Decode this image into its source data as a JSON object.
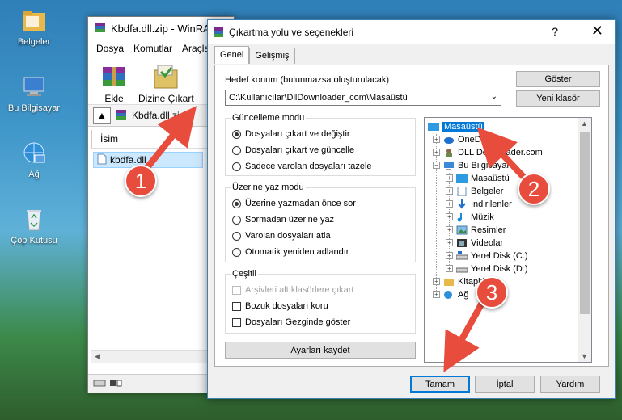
{
  "desktop": {
    "icons": [
      {
        "label": "Belgeler"
      },
      {
        "label": "Bu Bilgisayar"
      },
      {
        "label": "Ağ"
      },
      {
        "label": "Çöp Kutusu"
      }
    ]
  },
  "winrar": {
    "title": "Kbdfa.dll.zip - WinRA",
    "menu": [
      "Dosya",
      "Komutlar",
      "Araçla"
    ],
    "toolbar": {
      "add": "Ekle",
      "extract_to": "Dizine Çıkart"
    },
    "address": "Kbdfa.dll.zip",
    "column_name": "İsim",
    "file": "kbdfa.dll"
  },
  "dialog": {
    "title": "Çıkartma yolu ve seçenekleri",
    "help_symbol": "?",
    "close_symbol": "✕",
    "tabs": [
      "Genel",
      "Gelişmiş"
    ],
    "dest_label": "Hedef konum (bulunmazsa oluşturulacak)",
    "dest_value": "C:\\Kullanıcılar\\DllDownloader_com\\Masaüstü",
    "btn_show": "Göster",
    "btn_new_folder": "Yeni klasör",
    "update_group": {
      "title": "Güncelleme modu",
      "options": [
        "Dosyaları çıkart ve değiştir",
        "Dosyaları çıkart ve güncelle",
        "Sadece varolan dosyaları tazele"
      ],
      "selected": 0
    },
    "overwrite_group": {
      "title": "Üzerine yaz modu",
      "options": [
        "Üzerine yazmadan önce sor",
        "Sormadan üzerine yaz",
        "Varolan dosyaları atla",
        "Otomatik yeniden adlandır"
      ],
      "selected": 0
    },
    "misc_group": {
      "title": "Çeşitli",
      "options": [
        "Arşivleri alt klasörlere çıkart",
        "Bozuk dosyaları koru",
        "Dosyaları Gezginde göster"
      ]
    },
    "btn_save_settings": "Ayarları kaydet",
    "tree": [
      "Masaüstü",
      "OneDrive",
      "DLL Downloader.com",
      "Bu Bilgisayar",
      "Masaüstü",
      "Belgeler",
      "İndirilenler",
      "Müzik",
      "Resimler",
      "Videolar",
      "Yerel Disk (C:)",
      "Yerel Disk (D:)",
      "Kitaplıklar",
      "Ağ"
    ],
    "btn_ok": "Tamam",
    "btn_cancel": "İptal",
    "btn_help": "Yardım"
  },
  "markers": [
    "1",
    "2",
    "3"
  ],
  "colors": {
    "marker": "#e74c3c",
    "selection": "#0078d7"
  }
}
